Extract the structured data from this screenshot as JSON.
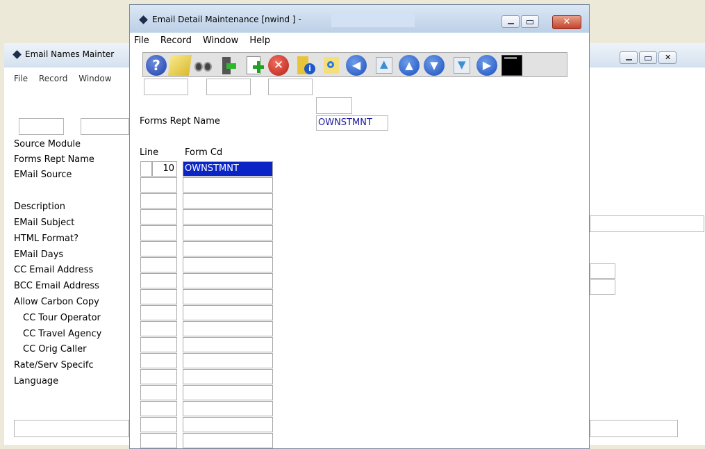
{
  "background_window": {
    "title": "Email Names Mainter",
    "menu": [
      "File",
      "Record",
      "Window"
    ],
    "labels": [
      {
        "text": "Source Module"
      },
      {
        "text": "Forms Rept Name"
      },
      {
        "text": "EMail Source"
      },
      {
        "text": "Description"
      },
      {
        "text": "EMail Subject"
      },
      {
        "text": "HTML Format?"
      },
      {
        "text": "EMail Days"
      },
      {
        "text": "CC Email Address"
      },
      {
        "text": "BCC Email Address"
      },
      {
        "text": "Allow Carbon Copy"
      },
      {
        "text": "CC Tour Operator"
      },
      {
        "text": "CC Travel Agency"
      },
      {
        "text": "CC Orig Caller"
      },
      {
        "text": "Rate/Serv Specifc"
      },
      {
        "text": "Language"
      }
    ]
  },
  "foreground_window": {
    "title": "Email Detail Maintenance [nwind  ] -",
    "menu": [
      "File",
      "Record",
      "Window",
      "Help"
    ],
    "close_label": "✕",
    "toolbar": [
      "help-icon",
      "notepad-icon",
      "binoculars-icon",
      "exit-icon",
      "add-record-icon",
      "delete-record-icon",
      "info-icon",
      "refresh-icon",
      "first-record-icon",
      "prev-page-icon",
      "previous-record-icon",
      "next-record-icon",
      "next-page-icon",
      "last-record-icon",
      "terminal-icon"
    ],
    "forms_rept_name_label": "Forms Rept Name",
    "forms_rept_name_value": "OWNSTMNT",
    "grid": {
      "columns": [
        "Line",
        "Form Cd"
      ],
      "rows": [
        {
          "line": "10",
          "form_cd": "OWNSTMNT"
        }
      ]
    }
  }
}
